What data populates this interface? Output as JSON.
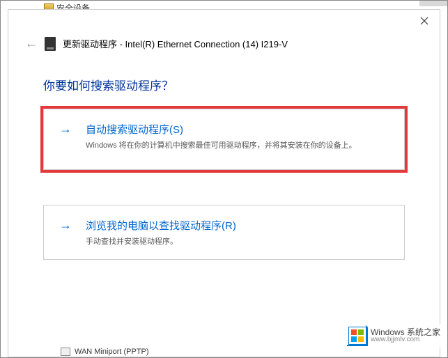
{
  "fragments": {
    "top_tree": "安全设备",
    "bottom_device": "WAN Miniport (PPTP)"
  },
  "dialog": {
    "title": "更新驱动程序 - Intel(R) Ethernet Connection (14) I219-V",
    "question": "你要如何搜索驱动程序？",
    "options": [
      {
        "title": "自动搜索驱动程序(S)",
        "desc": "Windows 将在你的计算机中搜索最佳可用驱动程序，并将其安装在你的设备上。"
      },
      {
        "title": "浏览我的电脑以查找驱动程序(R)",
        "desc": "手动查找并安装驱动程序。"
      }
    ]
  },
  "watermark": {
    "title": "Windows 系统之家",
    "url": "www.bjjmlv.com"
  }
}
